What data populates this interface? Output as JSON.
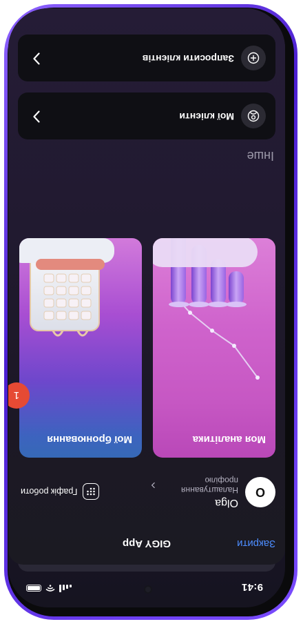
{
  "status": {
    "time": "9:41"
  },
  "header": {
    "close": "Закрити",
    "title": "GIGY App"
  },
  "profile": {
    "initial": "O",
    "name": "Olga",
    "subtitle": "Налаштування профілю"
  },
  "schedule": {
    "label": "Графік роботи"
  },
  "cards": {
    "analytics": {
      "title": "Моя аналітика"
    },
    "bookings": {
      "title": "Мої бронювання",
      "badge": "1"
    }
  },
  "other": {
    "title": "Інше",
    "items": [
      {
        "label": "Мої клієнти",
        "icon": "clients-icon"
      },
      {
        "label": "Запросити клієнтів",
        "icon": "invite-icon"
      }
    ]
  },
  "colors": {
    "accent_link": "#4d8dff",
    "badge": "#e64a34",
    "frame": "#6a3cf0"
  }
}
